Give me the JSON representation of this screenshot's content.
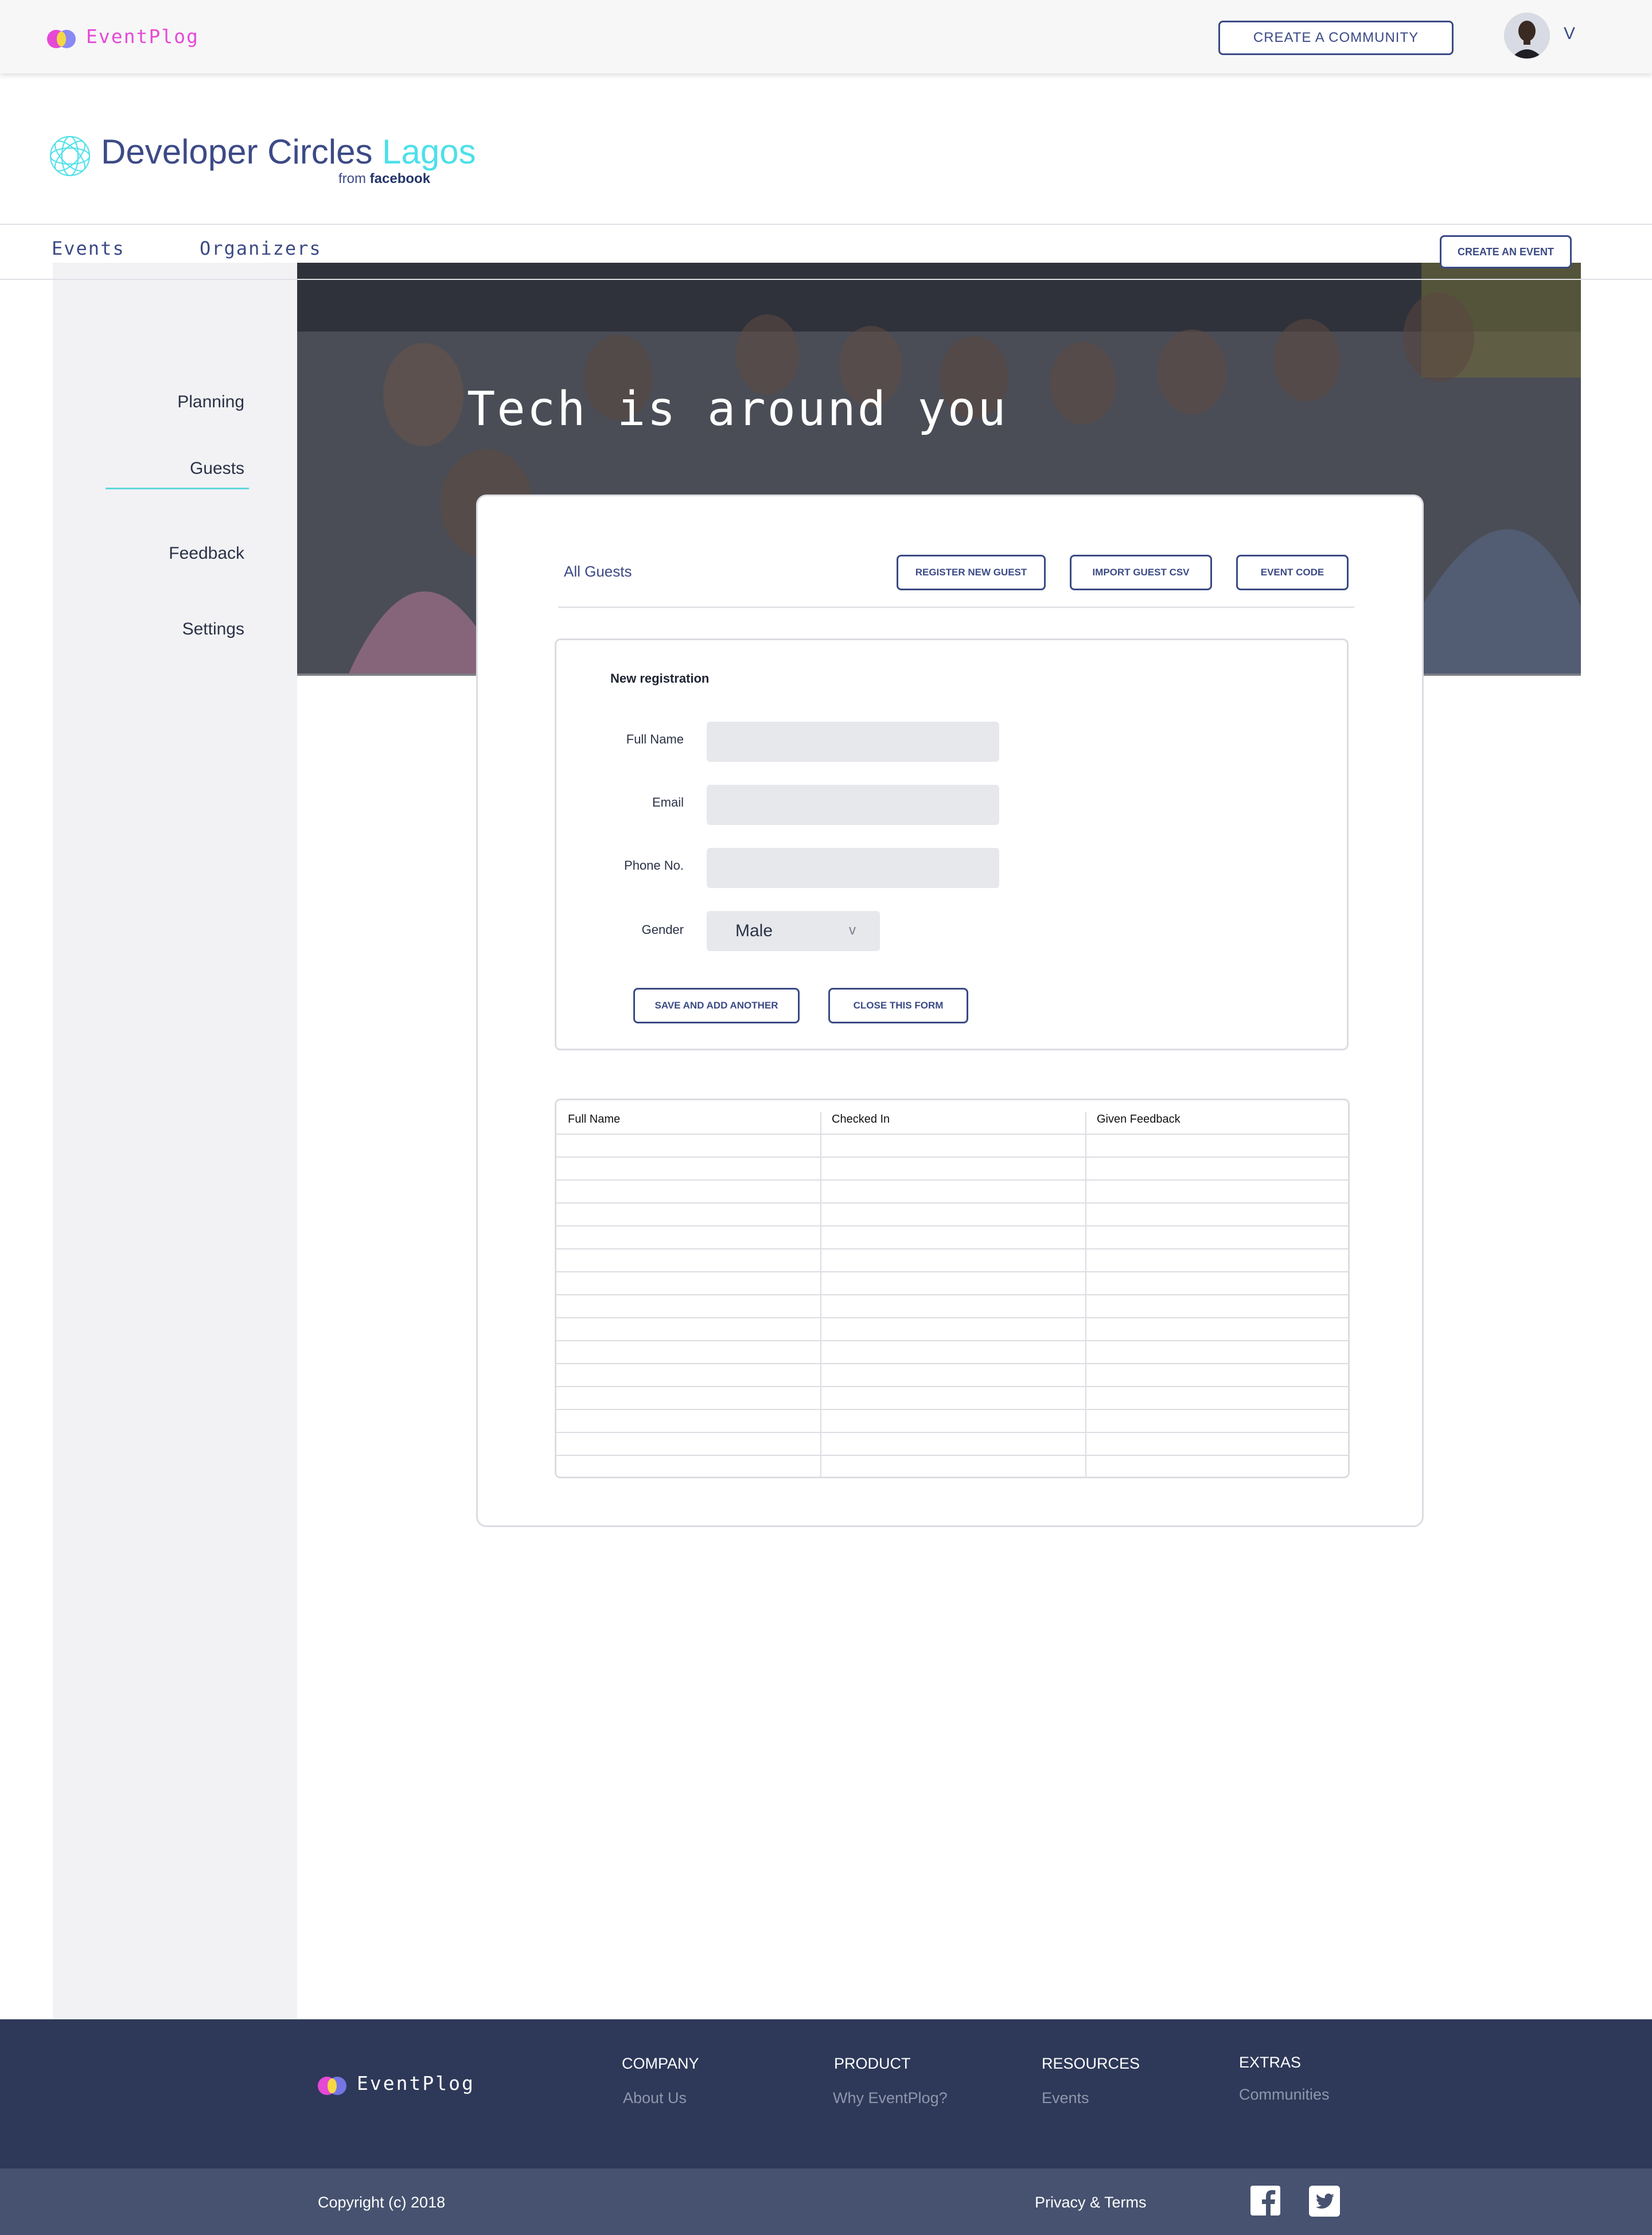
{
  "header": {
    "brand": "EventPlog",
    "create_community": "CREATE A COMMUNITY",
    "user_initial": "V"
  },
  "community": {
    "name": "Developer Circles",
    "city": "Lagos",
    "from_label": "from",
    "from_brand": "facebook"
  },
  "nav": {
    "events": "Events",
    "organizers": "Organizers",
    "create_event": "CREATE AN EVENT"
  },
  "sidebar": {
    "items": [
      {
        "label": "Planning"
      },
      {
        "label": "Guests",
        "active": true
      },
      {
        "label": "Feedback"
      },
      {
        "label": "Settings"
      }
    ]
  },
  "hero": {
    "title": "Tech is around you"
  },
  "guests": {
    "heading": "All Guests",
    "register_button": "REGISTER NEW GUEST",
    "import_button": "IMPORT GUEST CSV",
    "code_button": "EVENT CODE"
  },
  "form": {
    "title": "New registration",
    "full_name_label": "Full Name",
    "email_label": "Email",
    "phone_label": "Phone No.",
    "gender_label": "Gender",
    "gender_value": "Male",
    "gender_caret": "v",
    "save_button": "SAVE AND ADD ANOTHER",
    "close_button": "CLOSE THIS FORM"
  },
  "table": {
    "columns": [
      "Full Name",
      "Checked In",
      "Given Feedback"
    ],
    "rows": []
  },
  "footer": {
    "brand": "EventPlog",
    "columns": [
      {
        "heading": "COMPANY",
        "link": "About Us"
      },
      {
        "heading": "PRODUCT",
        "link": "Why EventPlog?"
      },
      {
        "heading": "RESOURCES",
        "link": "Events"
      },
      {
        "heading": "EXTRAS",
        "link": "Communities"
      }
    ],
    "copyright": "Copyright (c) 2018",
    "privacy": "Privacy & Terms"
  },
  "colors": {
    "brand_pink": "#e649d6",
    "primary_navy": "#3b4a85",
    "accent_cyan": "#4ce0ea",
    "footer_bg": "#2e3959",
    "subfooter_bg": "#46526f"
  },
  "icons": {
    "brand": "eventplog-logo-icon",
    "community": "developer-circles-logo-icon",
    "avatar": "user-avatar",
    "facebook": "facebook-icon",
    "twitter": "twitter-icon"
  }
}
